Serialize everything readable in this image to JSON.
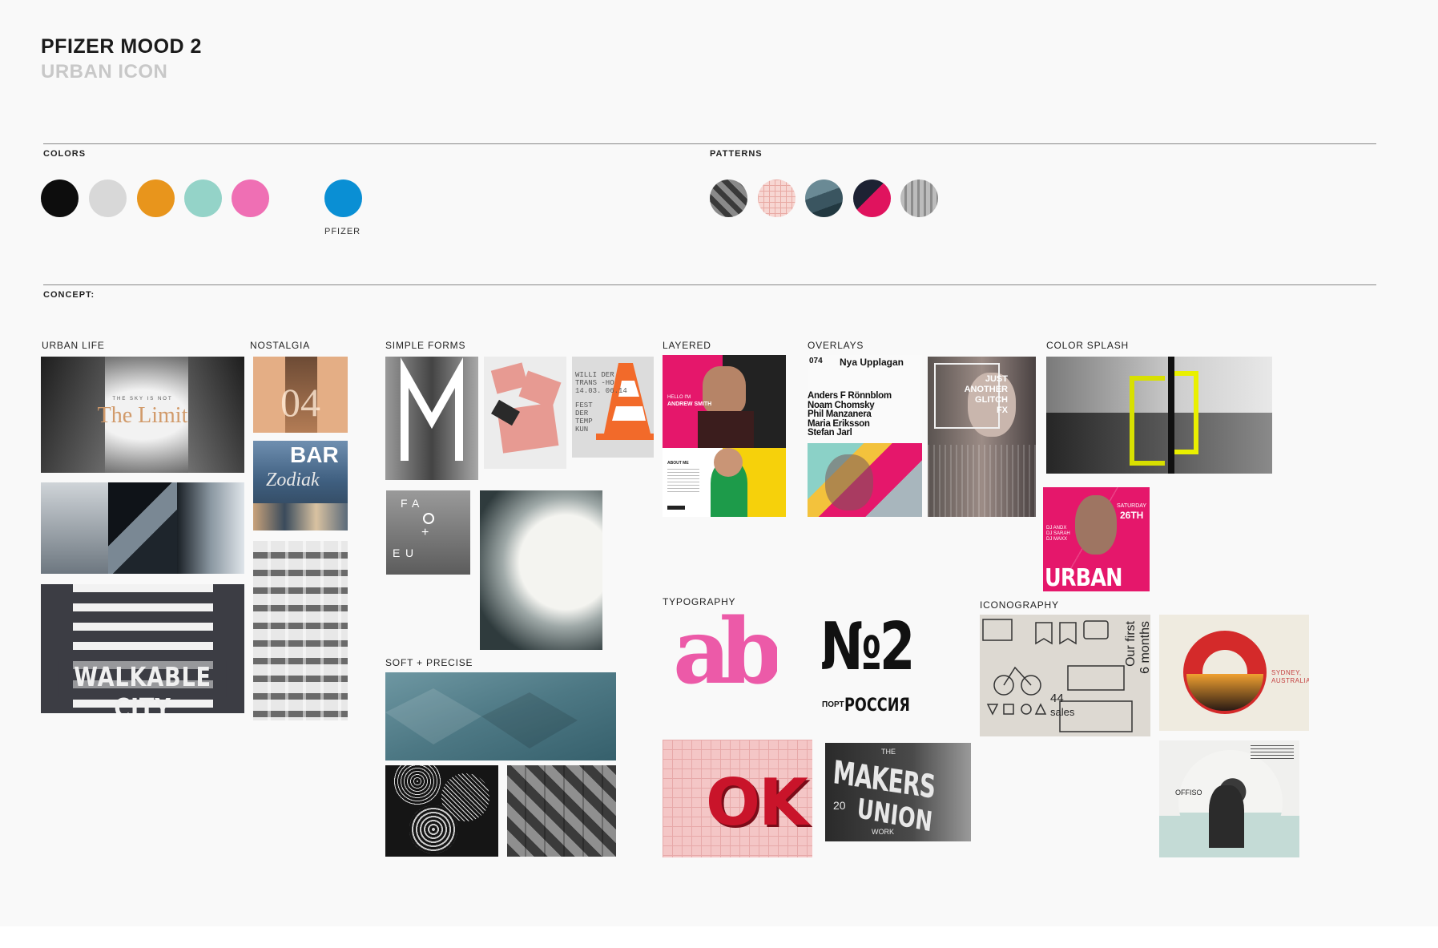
{
  "header": {
    "title": "PFIZER MOOD 2",
    "subtitle": "URBAN ICON"
  },
  "sections": {
    "colors": "COLORS",
    "patterns": "PATTERNS",
    "concept": "CONCEPT:"
  },
  "colors": {
    "swatches": [
      "#0d0d0d",
      "#d8d8d8",
      "#e8951c",
      "#94d3c8",
      "#ef6fb4"
    ],
    "pfizer_color": "#0a8fd4",
    "pfizer_label": "PFIZER"
  },
  "patterns": [
    "chevron-gray",
    "pink-grid",
    "teal-facets",
    "magenta-split",
    "gray-building"
  ],
  "categories": {
    "urban_life": "URBAN LIFE",
    "nostalgia": "NOSTALGIA",
    "simple_forms": "SIMPLE FORMS",
    "layered": "LAYERED",
    "overlays": "OVERLAYS",
    "color_splash": "COLOR SPLASH",
    "soft_precise": "SOFT + PRECISE",
    "typography": "TYPOGRAPHY",
    "iconography": "ICONOGRAPHY"
  },
  "tile_text": {
    "limit_small": "THE SKY IS NOT",
    "limit_big": "The Limit",
    "walkable": "WALKABLE CITY",
    "nostalgia_num": "04",
    "bar_sign": "BAR",
    "zodiak": "Zodiak",
    "poster_lines": [
      "WILLI  DER",
      "TRANS  -HO",
      "14.03.  06.14",
      "FEST",
      "DER",
      "TEMP",
      "KUN"
    ],
    "fa_letters": [
      "F",
      "A",
      "E",
      "U"
    ],
    "hello": "HELLO I'M",
    "andrew": "ANDREW SMITH",
    "about": "ABOUT ME",
    "nya_num": "074",
    "nya_title": "Nya Upplagan",
    "nya_names": [
      "Anders F Rönnblom",
      "Noam Chomsky",
      "Phil Manzanera",
      "Maria Eriksson",
      "Stefan Jarl"
    ],
    "glitch": [
      "JUST",
      "ANOTHER",
      "GLITCH",
      "FX"
    ],
    "urban_word": "URBAN",
    "saturday": "SATURDAY",
    "saturday_date": "26TH",
    "dj_lines": [
      "DJ ANDX",
      "DJ SARAH",
      "DJ MAXX"
    ],
    "ab": "ab",
    "no2": "№2",
    "port": "ПОРТ",
    "russia": "РОССИЯ",
    "ok": "OK",
    "makers": "MAKERS",
    "the": "THE",
    "union": "UNION",
    "work": "WORK",
    "twenty": "20",
    "our_first": "Our first",
    "six_months": "6 months",
    "sales_num": "44",
    "sales": "sales",
    "sydney": "SYDNEY,",
    "australia": "AUSTRALIA",
    "offiso": "OFFISO"
  }
}
